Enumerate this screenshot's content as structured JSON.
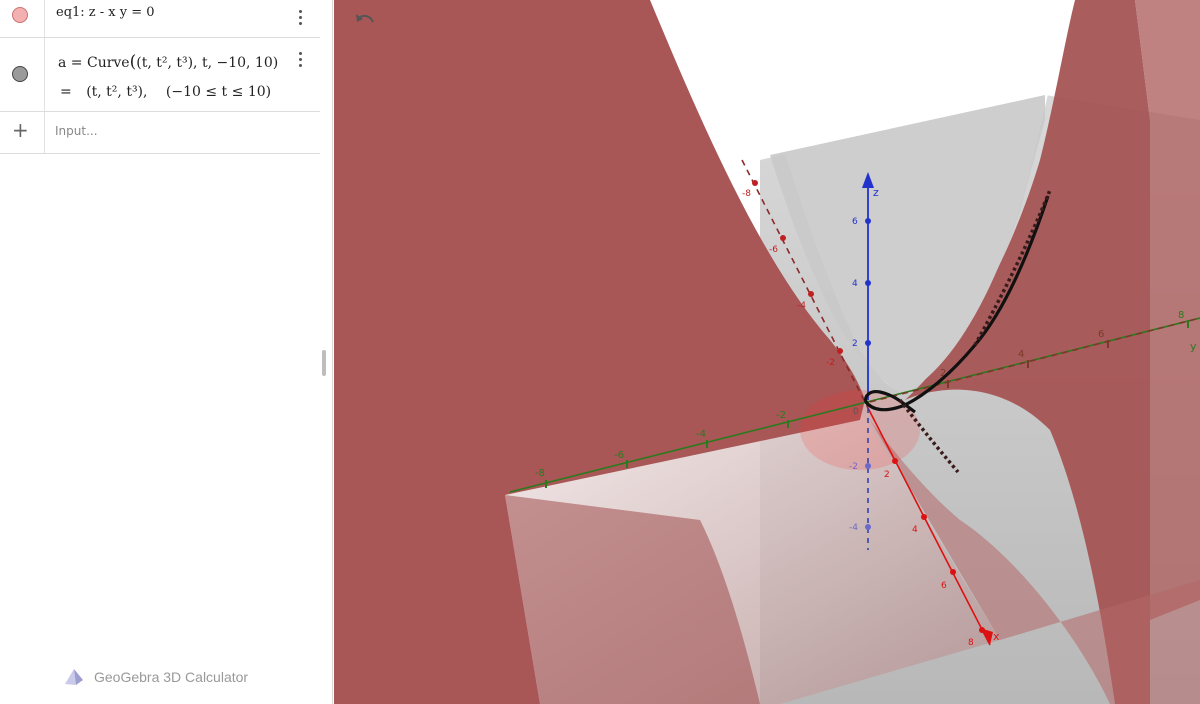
{
  "algebra": {
    "items": [
      {
        "name": "eq1",
        "definition": "eq1: z - x y = 0",
        "color": "#f3b0b0",
        "visible": true
      },
      {
        "name": "a",
        "definition_prefix": "a  =  Curve",
        "definition_args": "(t, t², t³), t, −10, 10)",
        "value_prefix": "=",
        "value": "(t, t², t³),",
        "domain": "(−10 ≤ t ≤ 10)",
        "color": "#9a9a9a",
        "visible": true
      }
    ],
    "input_placeholder": "Input...",
    "add_symbol": "+"
  },
  "brand": {
    "label": "GeoGebra 3D Calculator"
  },
  "view3d": {
    "surface_color": "#a04c4c",
    "axes": {
      "x": {
        "label": "x",
        "color": "#d11",
        "ticks": [
          "2",
          "4",
          "6",
          "8",
          "-2",
          "-4",
          "-6",
          "-8"
        ]
      },
      "y": {
        "label": "y",
        "color": "#2a7a1e",
        "ticks": [
          "-8",
          "-6",
          "-4",
          "-2",
          "2",
          "4",
          "6",
          "8"
        ]
      },
      "z": {
        "label": "z",
        "color": "#2233cc",
        "ticks": [
          "6",
          "4",
          "2",
          "-2",
          "-4"
        ]
      },
      "origin": "0"
    }
  }
}
